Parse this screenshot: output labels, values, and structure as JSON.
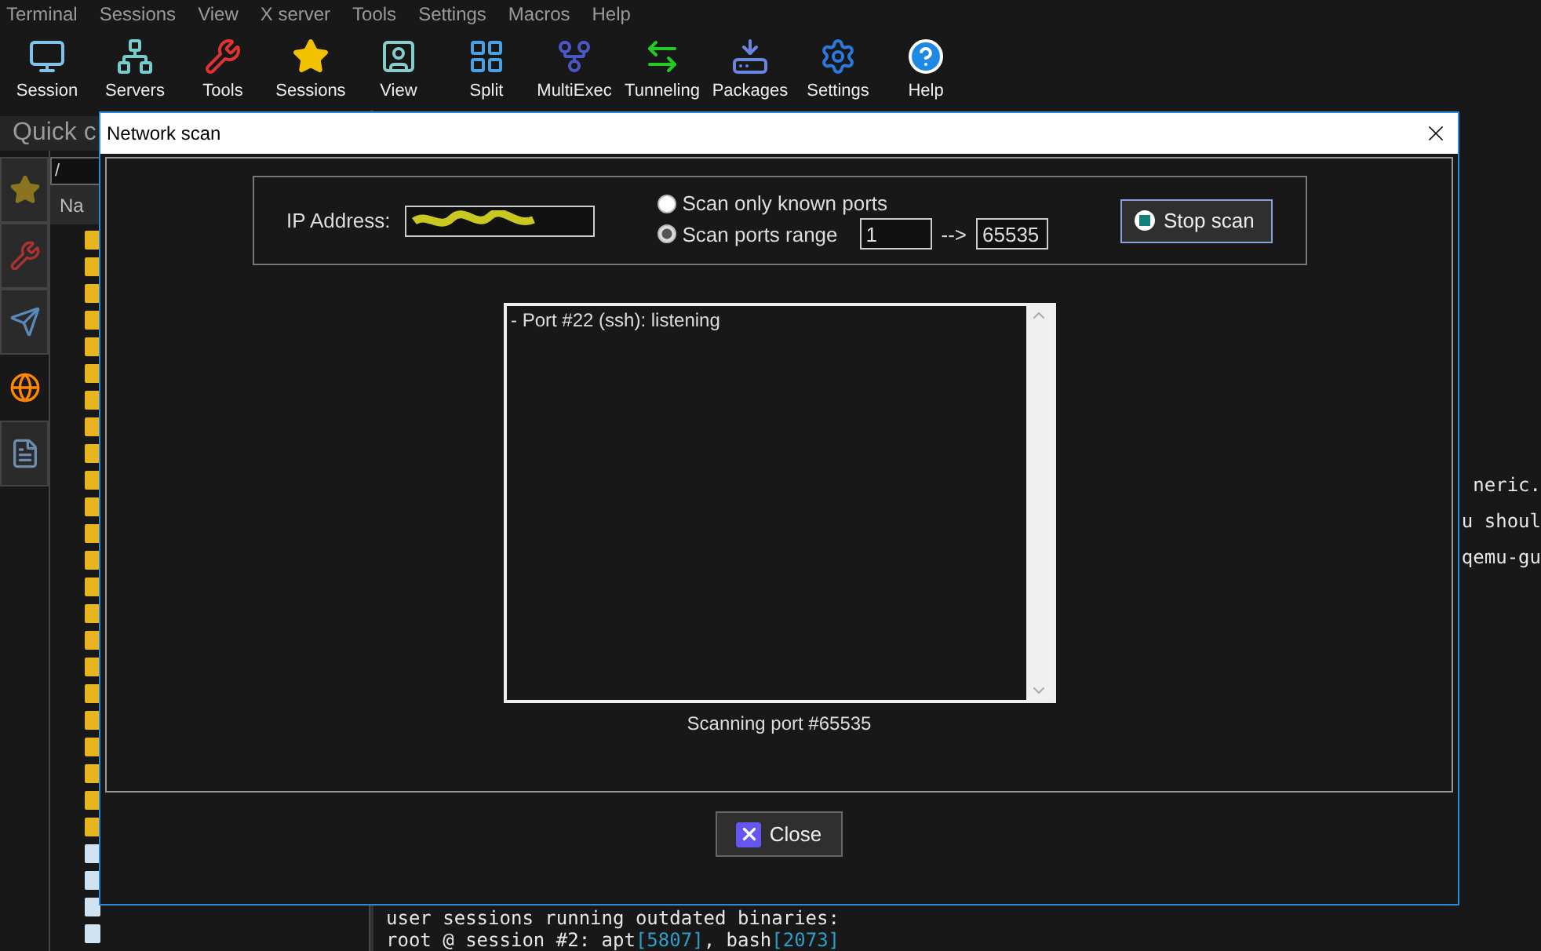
{
  "menu": [
    "Terminal",
    "Sessions",
    "View",
    "X server",
    "Tools",
    "Settings",
    "Macros",
    "Help"
  ],
  "toolbar": [
    "Session",
    "Servers",
    "Tools",
    "Sessions",
    "View",
    "Split",
    "MultiExec",
    "Tunneling",
    "Packages",
    "Settings",
    "Help"
  ],
  "quick_connect": {
    "placeholder": "Quick c"
  },
  "sidebar_tabs": [
    {
      "selected": false
    },
    {
      "selected": false
    },
    {
      "selected": false
    },
    {
      "selected": true
    },
    {
      "selected": false
    }
  ],
  "file_browser": {
    "path": "/",
    "column_1": "Na"
  },
  "terminal": {
    "fragments": [
      "neric.",
      "u shoul",
      "qemu-gu"
    ],
    "lines": [
      [
        {
          "text": "user sessions running outdated binaries:",
          "kind": "plain"
        }
      ],
      [
        {
          "text": " root @ session #2: apt",
          "kind": "plain"
        },
        {
          "text": "[5807]",
          "kind": "pid"
        },
        {
          "text": ", bash",
          "kind": "plain"
        },
        {
          "text": "[2073]",
          "kind": "pid"
        }
      ]
    ]
  },
  "dialog": {
    "title": "Network scan",
    "ip_label": "IP Address:",
    "options": [
      {
        "label": "Scan only known ports",
        "selected": false
      },
      {
        "label": "Scan ports range",
        "selected": true
      }
    ],
    "range_from": "1",
    "range_arrow": "-->",
    "range_to": "65535",
    "stop_button": "Stop scan",
    "results": [
      "- Port #22 (ssh):  listening"
    ],
    "status": "Scanning port #65535",
    "close_button": "Close"
  }
}
